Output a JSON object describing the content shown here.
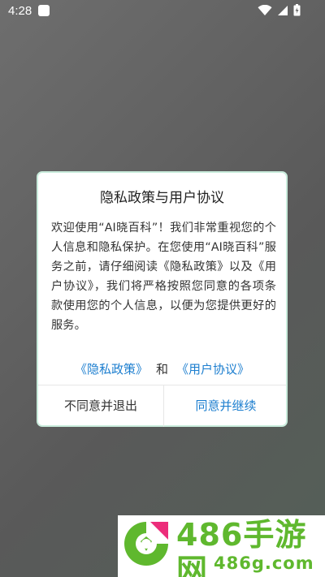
{
  "status_bar": {
    "time": "4:28",
    "icons": [
      "notification-icon",
      "wifi-icon",
      "signal-icon",
      "battery-icon"
    ]
  },
  "dialog": {
    "title": "隐私政策与用户协议",
    "body": "欢迎使用“AI晓百科”！我们非常重视您的个人信息和隐私保护。在您使用“AI晓百科”服务之前，请仔细阅读《隐私政策》以及《用户协议》，我们将严格按照您同意的各项条款使用您的个人信息，以便为您提供更好的服务。",
    "privacy_link": "《隐私政策》",
    "links_connector": "和",
    "agreement_link": "《用户协议》",
    "reject_label": "不同意并退出",
    "accept_label": "同意并继续"
  },
  "watermark": {
    "title": "486手游网",
    "url": "486g.com"
  },
  "colors": {
    "accent": "#1c7ecf",
    "dialog_border": "#c9ecdc",
    "watermark_green": "#5fb82e"
  }
}
